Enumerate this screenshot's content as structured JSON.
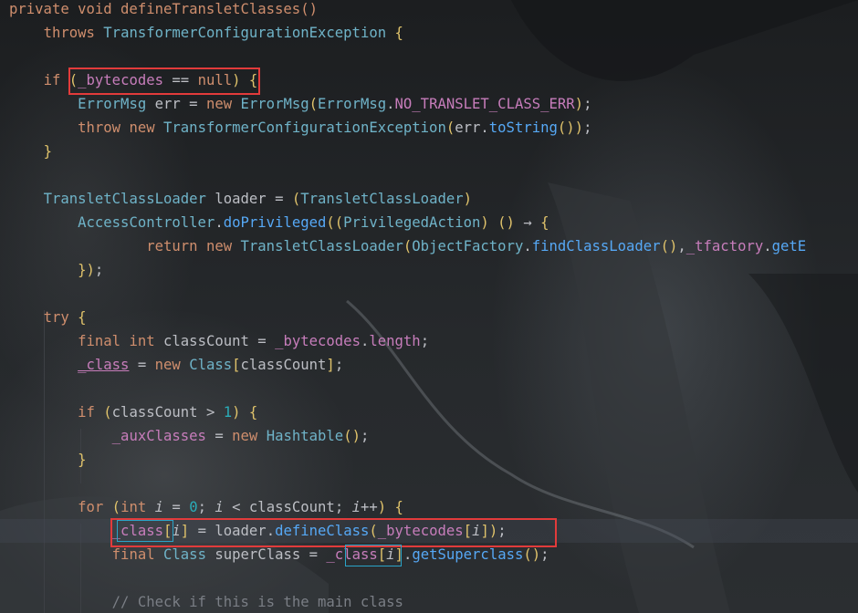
{
  "lines": [
    "private void defineTransletClasses()",
    "throws",
    "TransformerConfigurationException",
    "if",
    "_bytecodes",
    "null",
    "ErrorMsg",
    "err",
    "new",
    "NO_TRANSLET_CLASS_ERR",
    "throw",
    "toString",
    "TransletClassLoader",
    "loader",
    "AccessController",
    "doPrivileged",
    "PrivilegedAction",
    "return",
    "ObjectFactory",
    "findClassLoader",
    "_tfactory",
    "getE",
    "try",
    "final",
    "int",
    "classCount",
    "length",
    "_class",
    "Class",
    "1",
    "_auxClasses",
    "Hashtable",
    "for",
    "i",
    "0",
    "defineClass",
    "superClass",
    "getSuperclass",
    "// Check if this is the main class"
  ],
  "colors": {
    "keyword": "#cf8e6d",
    "field": "#c77dbb",
    "method": "#56a8f5",
    "number": "#2aacb8",
    "text": "#bcbec4",
    "comment": "#7a7e85",
    "highlight_box": "#e23b3b"
  }
}
